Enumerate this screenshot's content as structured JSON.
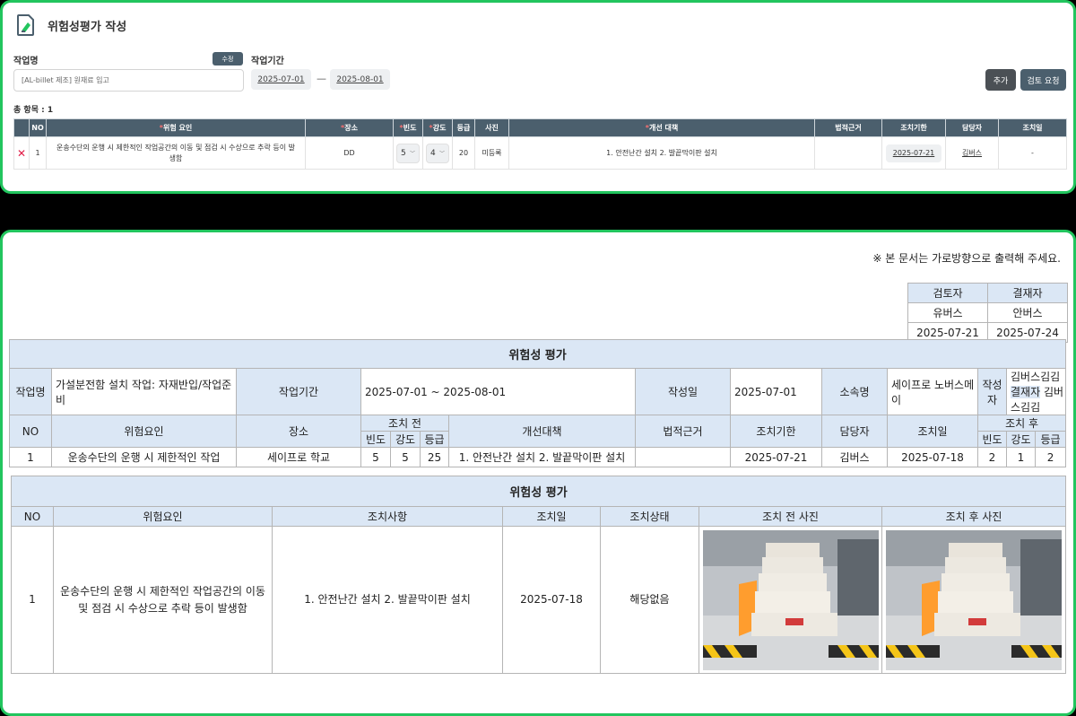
{
  "header": {
    "title": "위험성평가 작성"
  },
  "form": {
    "job_name_label": "작업명",
    "edit_badge": "수정",
    "period_label": "작업기간",
    "job_name_placeholder": "[AL-billet 제조] 원재료 입고",
    "date_from": "2025-07-01",
    "date_to": "2025-08-01",
    "dash": "—",
    "add_button": "추가",
    "review_button": "검토 요청",
    "total": "총 항목 : 1"
  },
  "grid": {
    "columns": {
      "no": "NO",
      "hazard": "위험 요인",
      "place": "장소",
      "freq": "빈도",
      "sev": "강도",
      "grade": "등급",
      "photo": "사진",
      "measure": "개선 대책",
      "legal": "법적근거",
      "deadline": "조치기한",
      "manager": "담당자",
      "action_date": "조치일"
    },
    "required_mark": "*",
    "delete_icon": "✕",
    "rows": [
      {
        "no": "1",
        "hazard": "운송수단의 운행 시 제한적인 작업공간의 이동 및 점검 시 수상으로 추락 등이 발생함",
        "place": "DD",
        "freq": "5",
        "sev": "4",
        "grade": "20",
        "photo": "미등록",
        "measure": "1. 안전난간 설치 2. 발끝막이판 설치",
        "legal": "",
        "deadline": "2025-07-21",
        "manager": "김버스",
        "action_date": "-"
      }
    ]
  },
  "print": {
    "notice": "※ 본 문서는 가로방향으로 출력해 주세요.",
    "approval": {
      "reviewer_label": "검토자",
      "approver_label": "결재자",
      "reviewer": "유버스",
      "approver": "안버스",
      "reviewer_date": "2025-07-21",
      "approver_date": "2025-07-24"
    },
    "report1": {
      "title": "위험성 평가",
      "job_label": "작업명",
      "job_value": "가설분전함 설치 작업: 자재반입/작업준비",
      "period_label": "작업기간",
      "period_value": "2025-07-01 ~ 2025-08-01",
      "created_label": "작성일",
      "created_value": "2025-07-01",
      "org_label": "소속명",
      "org_value": "세이프로 노버스메이",
      "author_label": "작성자",
      "author_value": "김버스김김",
      "approver_label": "결재자",
      "approver_value": "김버스김김",
      "cols": {
        "no": "NO",
        "hazard": "위험요인",
        "place": "장소",
        "before": "조치 전",
        "measure": "개선대책",
        "legal": "법적근거",
        "deadline": "조치기한",
        "manager": "담당자",
        "action_date": "조치일",
        "after": "조치 후",
        "freq": "빈도",
        "sev": "강도",
        "grade": "등급"
      },
      "row": {
        "no": "1",
        "hazard": "운송수단의 운행 시 제한적인 작업",
        "place": "세이프로 학교",
        "b_freq": "5",
        "b_sev": "5",
        "b_grade": "25",
        "measure": "1. 안전난간 설치 2. 발끝막이판 설치",
        "legal": "",
        "deadline": "2025-07-21",
        "manager": "김버스",
        "action_date": "2025-07-18",
        "a_freq": "2",
        "a_sev": "1",
        "a_grade": "2"
      }
    },
    "report2": {
      "title": "위험성 평가",
      "cols": {
        "no": "NO",
        "hazard": "위험요인",
        "action": "조치사항",
        "action_date": "조치일",
        "status": "조치상태",
        "before_photo": "조치 전 사진",
        "after_photo": "조치 후 사진"
      },
      "row": {
        "no": "1",
        "hazard": "운송수단의 운행 시 제한적인 작업공간의 이동 및 점검 시 수상으로 추락 등이 발생함",
        "action": "1. 안전난간 설치 2. 발끝막이판 설치",
        "action_date": "2025-07-18",
        "status": "해당없음"
      }
    }
  },
  "colors": {
    "accent_green": "#22c55e",
    "header_slate": "#4b5f6d",
    "report_header_blue": "#dbe7f5",
    "grade_red": "#dc2626"
  }
}
